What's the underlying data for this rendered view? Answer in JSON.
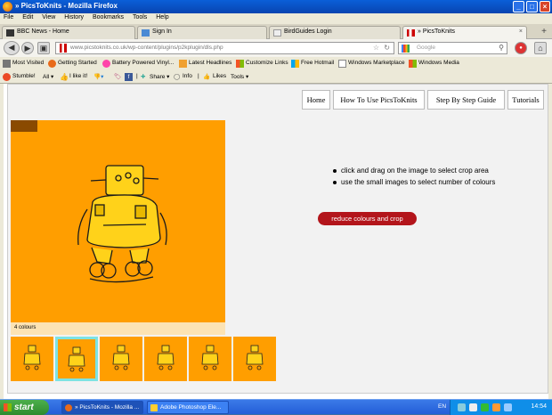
{
  "window": {
    "title": "» PicsToKnits - Mozilla Firefox",
    "min_icon": "minimize-icon",
    "max_icon": "maximize-icon",
    "close_icon": "close-icon"
  },
  "menu": [
    "File",
    "Edit",
    "View",
    "History",
    "Bookmarks",
    "Tools",
    "Help"
  ],
  "tabs": [
    {
      "label": "BBC News - Home",
      "icon": "bbc-icon",
      "active": false
    },
    {
      "label": "Sign In",
      "icon": "signin-icon",
      "active": false
    },
    {
      "label": "BirdGuides Login",
      "icon": "page-icon",
      "active": false
    },
    {
      "label": "» PicsToKnits",
      "icon": "picstoknits-icon",
      "active": true
    }
  ],
  "nav": {
    "url": "www.picstoknits.co.uk/wp-content/plugins/p2kplugin/dls.php",
    "search_placeholder": "Google"
  },
  "bookmarks": [
    "Most Visited",
    "Getting Started",
    "Battery Powered Vinyl...",
    "Latest Headlines",
    "Customize Links",
    "Free Hotmail",
    "Windows Marketplace",
    "Windows Media"
  ],
  "stumble": {
    "stumble": "Stumble!",
    "all": "All",
    "like": "I like it!",
    "share": "Share",
    "info": "Info",
    "likes": "Likes",
    "tools": "Tools"
  },
  "site_nav": [
    "Home",
    "How To Use PicsToKnits",
    "Step By Step Guide",
    "Tutorials"
  ],
  "image": {
    "colours_label": "4 colours",
    "bg_color": "#ff9e00"
  },
  "instructions": [
    "click and drag on the image to select crop area",
    "use the small images to select number of colours"
  ],
  "action_button": "reduce colours and crop",
  "thumbnails": {
    "count": 6,
    "selected_index": 1
  },
  "taskbar": {
    "start": "start",
    "items": [
      {
        "label": "» PicsToKnits - Mozilla ...",
        "active": true
      },
      {
        "label": "Adobe Photoshop Ele...",
        "active": false
      }
    ],
    "lang": "EN",
    "time": "14:54"
  },
  "colors": {
    "accent_button": "#b3151b",
    "selected_thumb": "#7de3e3",
    "titlebar": "#0a5fd8"
  }
}
